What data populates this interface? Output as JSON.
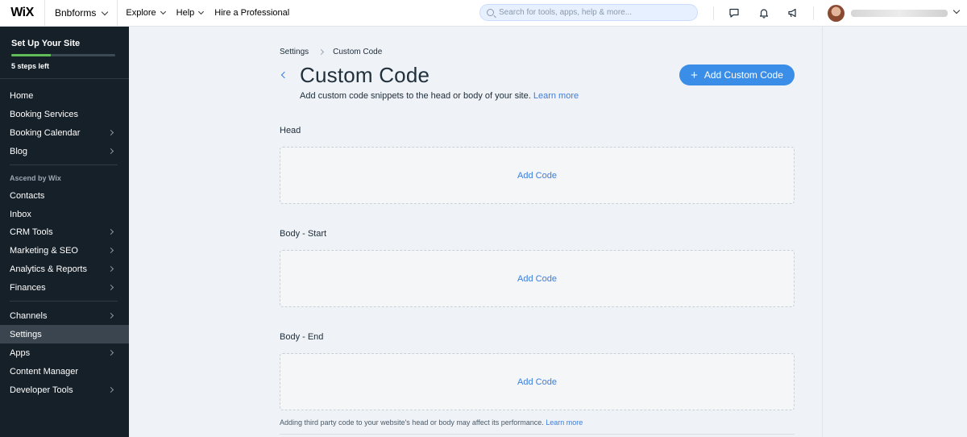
{
  "topbar": {
    "logo": "WiX",
    "site_name": "Bnbforms",
    "nav": [
      {
        "label": "Explore",
        "has_dropdown": true
      },
      {
        "label": "Help",
        "has_dropdown": true
      },
      {
        "label": "Hire a Professional",
        "has_dropdown": false
      }
    ],
    "search_placeholder": "Search for tools, apps, help & more...",
    "icons": [
      "chat-icon",
      "bell-icon",
      "megaphone-icon"
    ]
  },
  "sidebar": {
    "setup": {
      "title": "Set Up Your Site",
      "progress": 0.38,
      "steps_left": "5 steps left"
    },
    "items": [
      {
        "label": "Home",
        "arrow": false
      },
      {
        "label": "Booking Services",
        "arrow": false
      },
      {
        "label": "Booking Calendar",
        "arrow": true
      },
      {
        "label": "Blog",
        "arrow": true
      }
    ],
    "section_label": "Ascend by Wix",
    "ascend_items": [
      {
        "label": "Contacts",
        "arrow": false
      },
      {
        "label": "Inbox",
        "arrow": false
      },
      {
        "label": "CRM Tools",
        "arrow": true
      },
      {
        "label": "Marketing & SEO",
        "arrow": true
      },
      {
        "label": "Analytics & Reports",
        "arrow": true
      },
      {
        "label": "Finances",
        "arrow": true
      }
    ],
    "bottom_items": [
      {
        "label": "Channels",
        "arrow": true
      },
      {
        "label": "Settings",
        "arrow": false,
        "active": true
      },
      {
        "label": "Apps",
        "arrow": true
      },
      {
        "label": "Content Manager",
        "arrow": false
      },
      {
        "label": "Developer Tools",
        "arrow": true
      }
    ]
  },
  "main": {
    "breadcrumb": [
      "Settings",
      "Custom Code"
    ],
    "title": "Custom Code",
    "subtitle": "Add custom code snippets to the head or body of your site.",
    "subtitle_link": "Learn more",
    "add_button": "Add Custom Code",
    "sections": [
      {
        "label": "Head",
        "action": "Add Code"
      },
      {
        "label": "Body - Start",
        "action": "Add Code"
      },
      {
        "label": "Body - End",
        "action": "Add Code"
      }
    ],
    "footnote": "Adding third party code to your website's head or body may affect its performance.",
    "footnote_link": "Learn more"
  },
  "colors": {
    "accent": "#3b8ee8",
    "sidebar_bg": "#162029",
    "progress": "#60bc57"
  }
}
